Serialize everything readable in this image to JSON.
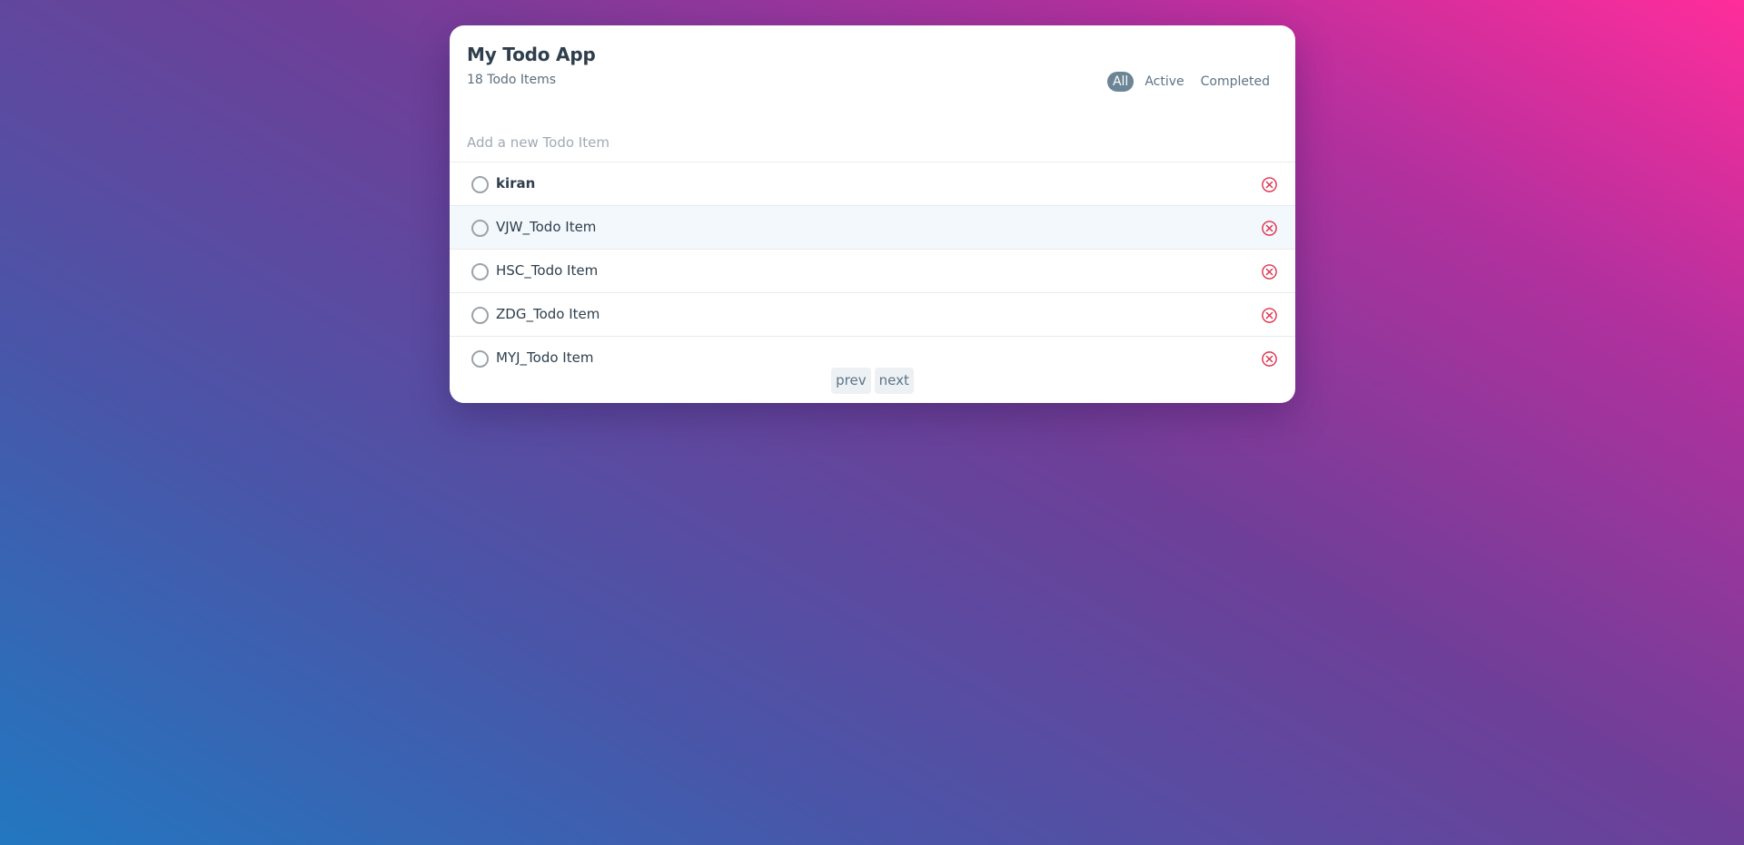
{
  "app": {
    "title": "My Todo App",
    "count_label": "18 Todo Items"
  },
  "filters": [
    {
      "label": "All",
      "active": true
    },
    {
      "label": "Active",
      "active": false
    },
    {
      "label": "Completed",
      "active": false
    }
  ],
  "add_input": {
    "placeholder": "Add a new Todo Item",
    "value": ""
  },
  "todos": [
    {
      "text": "kiran",
      "completed": false
    },
    {
      "text": "VJW_Todo Item",
      "completed": false
    },
    {
      "text": "HSC_Todo Item",
      "completed": false
    },
    {
      "text": "ZDG_Todo Item",
      "completed": false
    },
    {
      "text": "MYJ_Todo Item",
      "completed": false
    }
  ],
  "pagination": {
    "prev_label": "prev",
    "next_label": "next"
  },
  "colors": {
    "accent": "#6b8596",
    "delete": "#e0314f",
    "text": "#2e3e4c"
  },
  "icons": {
    "delete": "close-circle-icon",
    "checkbox": "circle-outline-icon"
  }
}
